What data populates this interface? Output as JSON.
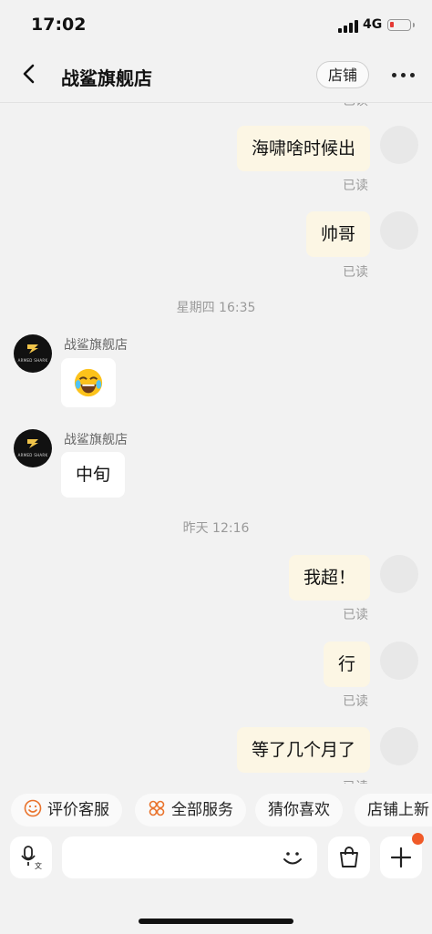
{
  "status_bar": {
    "time": "17:02",
    "network": "4G",
    "battery_percent": 15
  },
  "header": {
    "title": "战鲨旗舰店",
    "store_button": "店铺",
    "back_icon": "chevron-left-icon",
    "more_icon": "more-horizontal-icon"
  },
  "shop": {
    "name": "战鲨旗舰店",
    "logo_text": "ARMED SHARK"
  },
  "messages": {
    "top_read": "已读",
    "m1": {
      "text": "海啸啥时候出",
      "status": "已读"
    },
    "m2": {
      "text": "帅哥",
      "status": "已读"
    },
    "time1": "星期四 16:35",
    "s1": {
      "sender": "战鲨旗舰店",
      "emoji": "😂"
    },
    "s2": {
      "sender": "战鲨旗舰店",
      "text": "中旬"
    },
    "time2": "昨天 12:16",
    "m3": {
      "text": "我超！",
      "status": "已读"
    },
    "m4": {
      "text": "行",
      "status": "已读"
    },
    "m5": {
      "text": "等了几个月了",
      "status": "已读"
    }
  },
  "quick_actions": [
    "评价客服",
    "全部服务",
    "猜你喜欢",
    "店铺上新"
  ],
  "input": {
    "placeholder": ""
  },
  "colors": {
    "my_bubble": "#fcf6e4",
    "accent_orange": "#e9732c",
    "badge": "#f05a28",
    "background": "#f2f2f2"
  }
}
